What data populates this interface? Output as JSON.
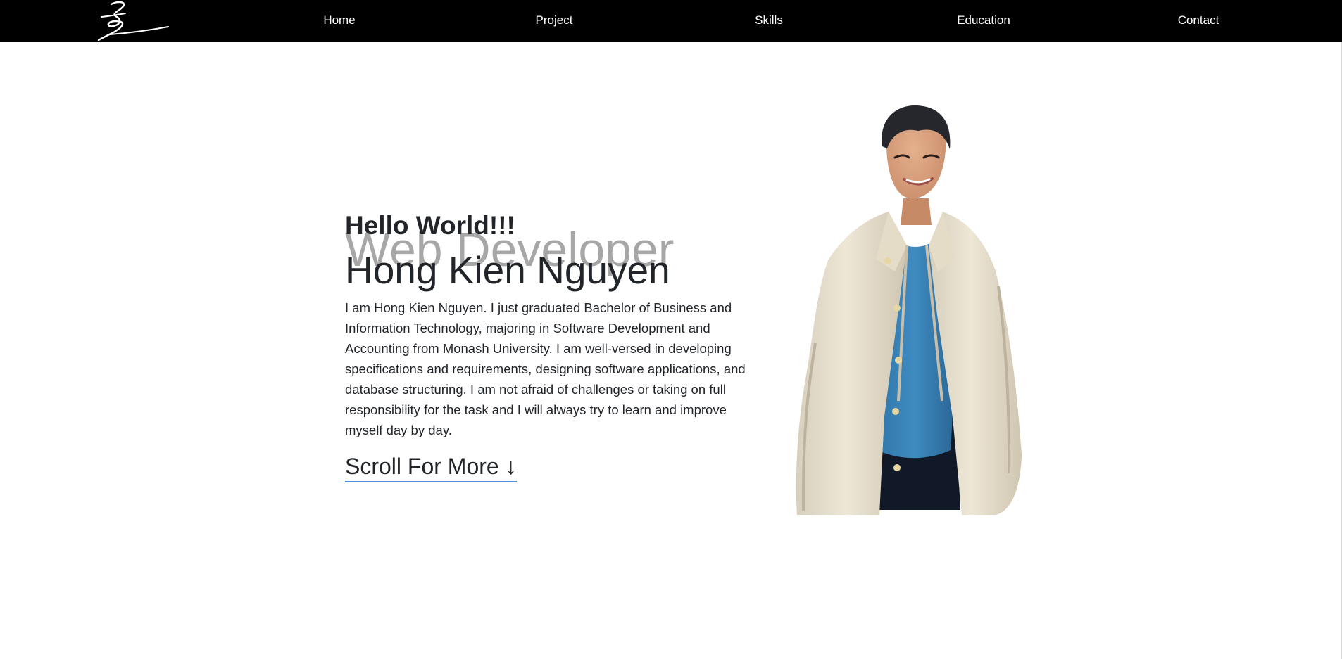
{
  "nav": {
    "logo": "signature-logo",
    "items": [
      {
        "label": "Home"
      },
      {
        "label": "Project"
      },
      {
        "label": "Skills"
      },
      {
        "label": "Education"
      },
      {
        "label": "Contact"
      }
    ]
  },
  "hero": {
    "greeting": "Hello World!!!",
    "role": "Web Developer",
    "name": "Hong Kien Nguyen",
    "bio": "I am Hong Kien Nguyen. I just graduated Bachelor of Business and Information Technology, majoring in Software Development and Accounting from Monash University. I am well-versed in developing specifications and requirements, designing software applications, and database structuring. I am not afraid of challenges or taking on full responsibility for the task and I will always try to learn and improve myself day by day.",
    "scroll_label": "Scroll For More ↓",
    "portrait": "portrait-photo"
  },
  "colors": {
    "nav_background": "#000000",
    "nav_text": "#ffffff",
    "text": "#212529",
    "role_text": "#9e9e9e",
    "link_underline": "#4a90e2"
  }
}
